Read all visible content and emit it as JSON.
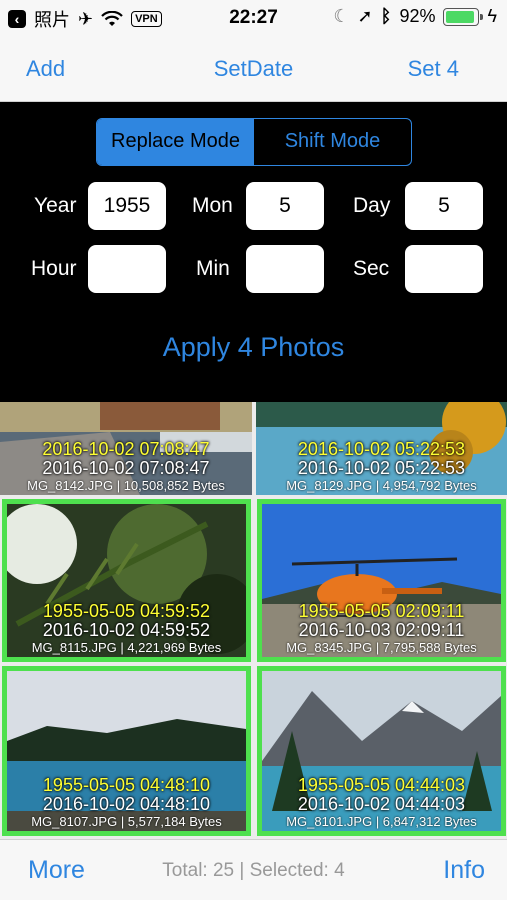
{
  "status_bar": {
    "back_app": "照片",
    "vpn": "VPN",
    "time": "22:27",
    "battery": "92%",
    "battery_level": 0.92
  },
  "nav": {
    "add_label": "Add",
    "title": "SetDate",
    "set_label": "Set 4"
  },
  "editor": {
    "modes": [
      "Replace Mode",
      "Shift Mode"
    ],
    "active_mode": "Replace Mode",
    "fields": {
      "year_label": "Year",
      "year_value": "1955",
      "mon_label": "Mon",
      "mon_value": "5",
      "day_label": "Day",
      "day_value": "5",
      "hour_label": "Hour",
      "hour_value": "",
      "min_label": "Min",
      "min_value": "",
      "sec_label": "Sec",
      "sec_value": ""
    },
    "apply_label": "Apply 4 Photos"
  },
  "photos": [
    {
      "new_date": "2016-10-02 07:08:47",
      "orig_date": "2016-10-02 07:08:47",
      "file": "MG_8142.JPG | 10,508,852 Bytes",
      "selected": false
    },
    {
      "new_date": "2016-10-02 05:22:53",
      "orig_date": "2016-10-02 05:22:53",
      "file": "MG_8129.JPG | 4,954,792 Bytes",
      "selected": false
    },
    {
      "new_date": "1955-05-05 04:59:52",
      "orig_date": "2016-10-02 04:59:52",
      "file": "MG_8115.JPG | 4,221,969 Bytes",
      "selected": true
    },
    {
      "new_date": "1955-05-05 02:09:11",
      "orig_date": "2016-10-03 02:09:11",
      "file": "MG_8345.JPG | 7,795,588 Bytes",
      "selected": true
    },
    {
      "new_date": "1955-05-05 04:48:10",
      "orig_date": "2016-10-02 04:48:10",
      "file": "MG_8107.JPG | 5,577,184 Bytes",
      "selected": true
    },
    {
      "new_date": "1955-05-05 04:44:03",
      "orig_date": "2016-10-02 04:44:03",
      "file": "MG_8101.JPG | 6,847,312 Bytes",
      "selected": true
    }
  ],
  "toolbar": {
    "more_label": "More",
    "status": "Total: 25 | Selected: 4",
    "info_label": "Info"
  },
  "colors": {
    "accent": "#2f86e0",
    "selection": "#4ee04e",
    "new_date_text": "#ffff33"
  }
}
